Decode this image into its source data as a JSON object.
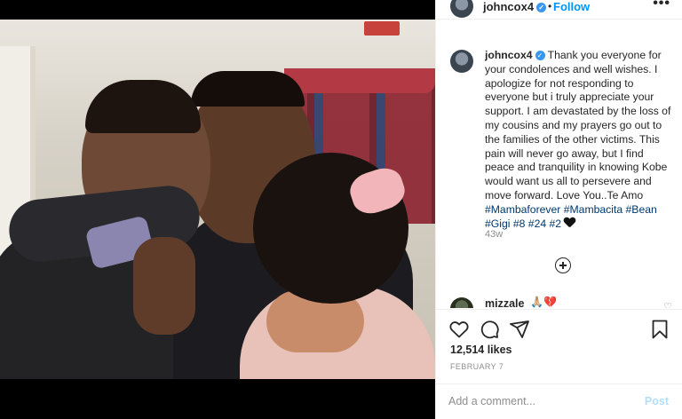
{
  "post": {
    "username": "johncox4",
    "verified": true,
    "separator": "•",
    "follow_label": "Follow",
    "more_label": "•••"
  },
  "caption": {
    "username": "johncox4",
    "text": "Thank you everyone for your condolences and well wishes. I apologize for not responding to everyone but i truly appreciate your support. I am devastated by the loss of my cousins and my prayers go out to the families of the other victims. This pain will never go away, but I find peace and tranquility in knowing Kobe would want us all to persevere and move forward. Love You..Te Amo",
    "hashtags": [
      "#Mambaforever",
      "#Mambacita",
      "#Bean",
      "#Gigi",
      "#8",
      "#24",
      "#2"
    ],
    "time_ago": "43w"
  },
  "comment": {
    "username": "mizzale",
    "emoji": "🙏🏼💔"
  },
  "stats": {
    "likes": "12,514 likes",
    "date": "FEBRUARY 7"
  },
  "add_comment": {
    "placeholder": "Add a comment...",
    "post_label": "Post"
  },
  "icons": [
    "heart-icon",
    "comment-icon",
    "share-icon",
    "bookmark-icon",
    "plus-circle-icon",
    "more-icon",
    "verified-icon"
  ],
  "colors": {
    "link": "#0095f6",
    "hashtag": "#00376b",
    "muted": "#8e8e8e",
    "post_disabled": "#b2dffc"
  }
}
